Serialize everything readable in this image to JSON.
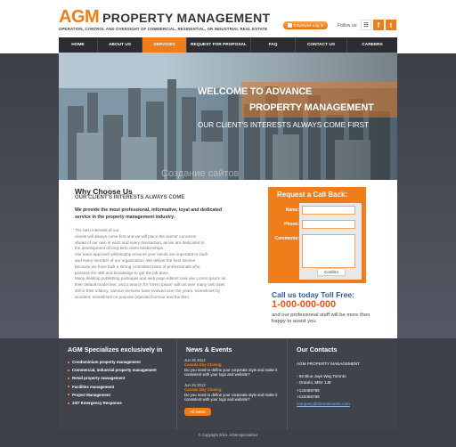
{
  "header": {
    "logo_agm": "AGM",
    "logo_rest": "PROPERTY MANAGEMENT",
    "tagline": "OPERATION, CONTROL AND OVERSIGHT OF COMMERCIAL, RESIDENTIAL, OR INDUSTRIAL REAL ESTATE",
    "login_label": "Employee Log In",
    "follow_label": "Follow us:",
    "social": [
      {
        "icon": "rss-icon",
        "glyph": "☷"
      },
      {
        "icon": "facebook-icon",
        "glyph": "f"
      },
      {
        "icon": "twitter-icon",
        "glyph": "t"
      }
    ]
  },
  "nav": {
    "items": [
      {
        "label": "HOME",
        "active": false
      },
      {
        "label": "ABOUT US",
        "active": false
      },
      {
        "label": "SERVICES",
        "active": true
      },
      {
        "label": "REQUEST FOR PROPOSAL",
        "active": false
      },
      {
        "label": "FAQ",
        "active": false
      },
      {
        "label": "CONTACT US",
        "active": false
      },
      {
        "label": "CAREERS",
        "active": false
      }
    ]
  },
  "hero": {
    "line1": "WELCOME TO ADVANCE",
    "line2": "PROPERTY MANAGEMENT",
    "line3": "OUR CLIENT'S INTERESTS ALWAYS COME FIRST",
    "watermark": "Создание сайтов"
  },
  "why": {
    "title": "Why Choose Us",
    "subtitle": "OUR CLIENT'S INTERESTS ALWAYS COME",
    "lead": "We provide the most professional, informative, loyal and dedicated service in the property management industry.",
    "body": [
      "The best interests of our",
      "clients will always come first and we will place the clients' concerns",
      "ahead of our own in each and every transaction, as we are dedicated to",
      "the development of long-term client relationships.",
      "Our team-approach philosophy ensures your needs are important to each",
      "and every member of our organization. We deliver the best service",
      "because we have built a strong committed team of professionals who",
      "possess the skill and knowledge to get the job done.",
      "Many desktop publishing packages and web page editors now use Lorem Ipsum as",
      "their default model text, and a search for 'lorem ipsum' will uncover many web sites",
      "still in their infancy. Various versions have evolved over the years, sometimes by",
      "accident, sometimes on purpose (injected humour and the like)."
    ]
  },
  "callback": {
    "title": "Request a Call Back:",
    "name_label": "Name:",
    "phone_label": "Phone:",
    "comments_label": "Comments:",
    "confirm_label": "Confirm"
  },
  "call": {
    "title": "Call us today Toll Free:",
    "number": "1-000-000-000",
    "desc": "and our professional staff will be more then happy to assist you"
  },
  "footer": {
    "specializes_title": "AGM Specializes exclusively in",
    "specializes_items": [
      "Condominium property management",
      "Commercial, industrial property management",
      "Retail property management",
      "Facilities management",
      "Project Management",
      "24/7 Emergency Response"
    ],
    "news_title": "News & Events",
    "news": [
      {
        "date": "Jun 26 2012",
        "head": "Canada Day Closing",
        "text": "Do you need to define your corporate style and make it consistent with your logo and website?"
      },
      {
        "date": "Jun 26 2012",
        "head": "Canada Day Closing",
        "text": "Do you need to define your corporate style and make it consistent with your logo and website?"
      }
    ],
    "all_news_label": "All News",
    "contacts_title": "Our Contacts",
    "company": "AGM PROPERTY MANAGEMENT",
    "address1": "- 56 Blue Jays Way,Toronto",
    "address2": "- Ontario, M5V 1J8",
    "phone1": "+123456789",
    "phone2": "+123456789",
    "email": "company@domainname.com"
  },
  "copyright": "© Copyright 2012. AGM Specializes",
  "colors": {
    "accent": "#f07d1a",
    "nav_bg": "#2b2d33",
    "footer_bg": "#40434c"
  }
}
